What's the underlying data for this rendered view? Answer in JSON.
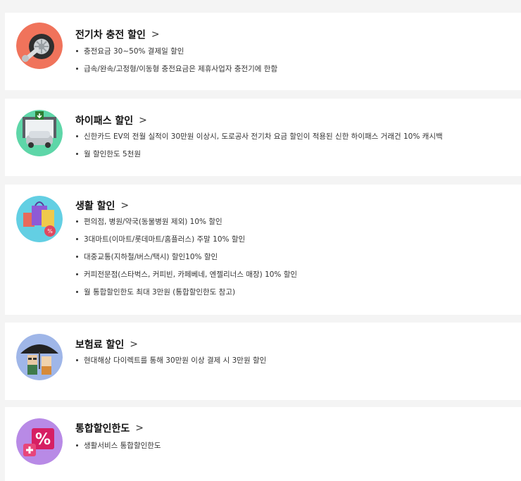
{
  "benefits": [
    {
      "title": "전기차 충전 할인",
      "icon": "tire-wrench-icon",
      "items": [
        "충전요금 30~50% 결제일 할인",
        "급속/완속/고정형/이동형 충전요금은 제휴사업자 충전기에 한함"
      ]
    },
    {
      "title": "하이패스 할인",
      "icon": "toll-gate-car-icon",
      "items": [
        "신한카드 EV의 전월 실적이 30만원 이상시, 도로공사 전기차 요금 할인이 적용된 신한 하이패스 거래건 10% 캐시백",
        "월 할인한도 5천원"
      ]
    },
    {
      "title": "생활 할인",
      "icon": "shopping-bag-icon",
      "items": [
        "편의점, 병원/약국(동물병원 제외) 10% 할인",
        "3대마트(이마트/롯데마트/홈플러스) 주말 10% 할인",
        "대중교통(지하철/버스/택시) 할인10% 할인",
        "커피전문점(스타벅스, 커피빈, 카페베네, 엔젤리너스 매장) 10% 할인",
        "월 통합할인한도 최대 3만원 (통합할인한도 참고)"
      ]
    },
    {
      "title": "보험료 할인",
      "icon": "umbrella-people-icon",
      "items": [
        "현대해상 다이렉트를 통해 30만원 이상 결제 시 3만원 할인"
      ]
    },
    {
      "title": "통합할인한도",
      "icon": "percent-plus-icon",
      "items": [
        "생활서비스 통합할인한도"
      ]
    }
  ],
  "chevron": ">"
}
